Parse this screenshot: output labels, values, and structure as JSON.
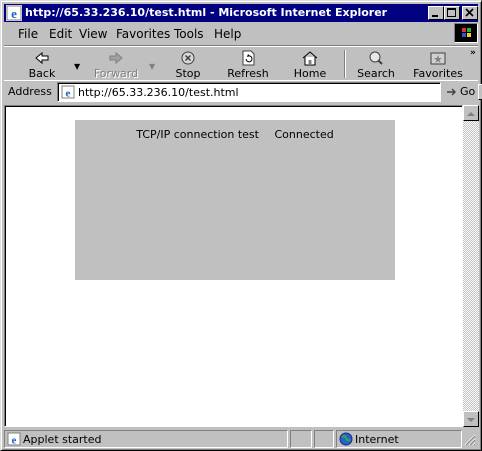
{
  "window": {
    "title": "http://65.33.236.10/test.html - Microsoft Internet Explorer"
  },
  "menu": {
    "items": [
      "File",
      "Edit",
      "View",
      "Favorites",
      "Tools",
      "Help"
    ]
  },
  "toolbar": {
    "back": "Back",
    "forward": "Forward",
    "stop": "Stop",
    "refresh": "Refresh",
    "home": "Home",
    "search": "Search",
    "favorites": "Favorites"
  },
  "address": {
    "label": "Address",
    "value": "http://65.33.236.10/test.html",
    "go": "Go"
  },
  "page": {
    "label": "TCP/IP connection test",
    "status": "Connected",
    "panel_color": "#c0c0c0"
  },
  "status": {
    "text": "Applet started",
    "zone": "Internet"
  },
  "colors": {
    "titlebar": "#000080",
    "chrome": "#c0c0c0"
  },
  "icons": {
    "title": "ie-logo-icon",
    "back": "back-arrow-icon",
    "forward": "forward-arrow-icon",
    "stop": "stop-icon",
    "refresh": "refresh-icon",
    "home": "home-icon",
    "search": "search-icon",
    "favorites": "favorites-icon",
    "go": "go-arrow-icon",
    "zone": "globe-icon"
  }
}
